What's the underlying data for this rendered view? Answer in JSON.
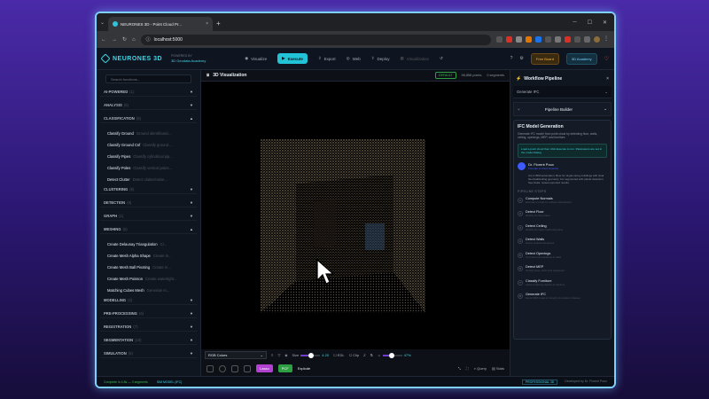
{
  "browser": {
    "tab_title": "NEURONES 3D - Point Cloud Pr...",
    "url": "localhost:5000"
  },
  "header": {
    "logo": "NEURONES 3D",
    "powered_by": "POWERED BY",
    "powered_org": "3D Geodata Academy",
    "nav": [
      {
        "label": "Visualize"
      },
      {
        "label": "Execute",
        "active": true
      },
      {
        "label": "Export"
      },
      {
        "label": "Web"
      },
      {
        "label": "Deploy"
      },
      {
        "label": "Visualization"
      }
    ],
    "free_badge": "Free Board",
    "academy_badge": "3D Academy"
  },
  "sidebar": {
    "search_placeholder": "Search functions...",
    "categories_top": [
      {
        "label": "AI-POWERED",
        "count": "(1)"
      },
      {
        "label": "ANALYSIS",
        "count": "(6)"
      },
      {
        "label": "CLASSIFICATION",
        "count": "(5)"
      }
    ],
    "classification_items": [
      {
        "label": "Classify Ground",
        "desc": "Ground identificatio..."
      },
      {
        "label": "Classify Ground Csf",
        "desc": "Classify ground ..."
      },
      {
        "label": "Classify Pipes",
        "desc": "Classify cylindrical pip..."
      },
      {
        "label": "Classify Poles",
        "desc": "Classify vertical poles..."
      },
      {
        "label": "Detect Clutter",
        "desc": "Detect clutter/noise..."
      }
    ],
    "categories_mid": [
      {
        "label": "CLUSTERING",
        "count": "(5)"
      },
      {
        "label": "DETECTION",
        "count": "(8)"
      },
      {
        "label": "GRAPH",
        "count": "(1)"
      },
      {
        "label": "MESHING",
        "count": "(5)"
      }
    ],
    "meshing_items": [
      {
        "label": "Create Delaunay Triangulation",
        "desc": "Cr..."
      },
      {
        "label": "Create Mesh Alpha Shape",
        "desc": "Create m..."
      },
      {
        "label": "Create Mesh Ball Pivoting",
        "desc": "Create m..."
      },
      {
        "label": "Create Mesh Poisson",
        "desc": "Create watertight..."
      },
      {
        "label": "Matching Cubes Mesh",
        "desc": "Generate m..."
      }
    ],
    "categories_bottom": [
      {
        "label": "MODELLING",
        "count": "(2)"
      },
      {
        "label": "PRE-PROCESSING",
        "count": "(6)"
      },
      {
        "label": "REGISTRATION",
        "count": "(7)"
      },
      {
        "label": "SEGMENTATION",
        "count": "(10)"
      },
      {
        "label": "SIMULATION",
        "count": "(5)"
      }
    ]
  },
  "viewer": {
    "title": "3D Visualization",
    "badge": "DEFAULT",
    "points": "98,858 points",
    "segments": "0 segments",
    "color_mode": "RGB Colors",
    "size_label": "Size",
    "size_value": "4.20",
    "size_fraction": 0.55,
    "edl_label": "EDL",
    "clip_label": "Clip",
    "z_label": "Z",
    "opacity_value": "47%",
    "opacity_fraction": 0.47,
    "lasso_label": "Lasso",
    "pcl_label": "PCF",
    "explode_label": "Explode",
    "query_label": "Query",
    "stats_label": "Stats"
  },
  "rpanel": {
    "title": "Workflow Pipeline",
    "dropdown": "Generate IFC",
    "builder": "Pipeline Builder",
    "card_title": "IFC Model Generation",
    "card_sub": "Generate IFC model from point cloud by detecting floor, walls, ceiling, openings, MEP, and furniture.",
    "info": "Load a point cloud then click Execute to run. Parameters are set in the model dialog.",
    "author": "Dr. Florent Poux",
    "role": "Founder & Chief Scientist",
    "bio": "3-in-1 BIM automation. Best for single-storey buildings with clear floor/wall/ceiling geometry. For segmented with planar detection. See Delta. review exported results.",
    "steps_label": "PIPELINE STEPS",
    "steps": [
      {
        "n": "1",
        "name": "Compute Normals",
        "desc": "Estimate normals for surface classification"
      },
      {
        "n": "2",
        "name": "Detect Floor",
        "desc": "Identify the floor plane"
      },
      {
        "n": "3",
        "name": "Detect Ceiling",
        "desc": "Identify the upper horizontal plane"
      },
      {
        "n": "4",
        "name": "Detect Walls",
        "desc": "Detect vertical wall planes"
      },
      {
        "n": "5",
        "name": "Detect Openings",
        "desc": "Find doors and windows in walls"
      },
      {
        "n": "6",
        "name": "Detect MEP",
        "desc": "Identify pipes, ducts and equipment"
      },
      {
        "n": "7",
        "name": "Classify Furniture",
        "desc": "Label remaining objects as furniture"
      },
      {
        "n": "8",
        "name": "Generate IFC",
        "desc": "Export BIM model to Industry Foundation Classes"
      }
    ]
  },
  "status": {
    "left": "Complete in 4.8s — 0 segments",
    "mode": "SIM MODEL (IFC)",
    "tag": "PROFESSIONAL 3D",
    "right": "Developed by Dr. Florent Poux"
  },
  "colors": {
    "accent": "#22c3d6",
    "lasso": "#b041d1",
    "pcl": "#2ea043",
    "frame": "#7fd0ff"
  }
}
